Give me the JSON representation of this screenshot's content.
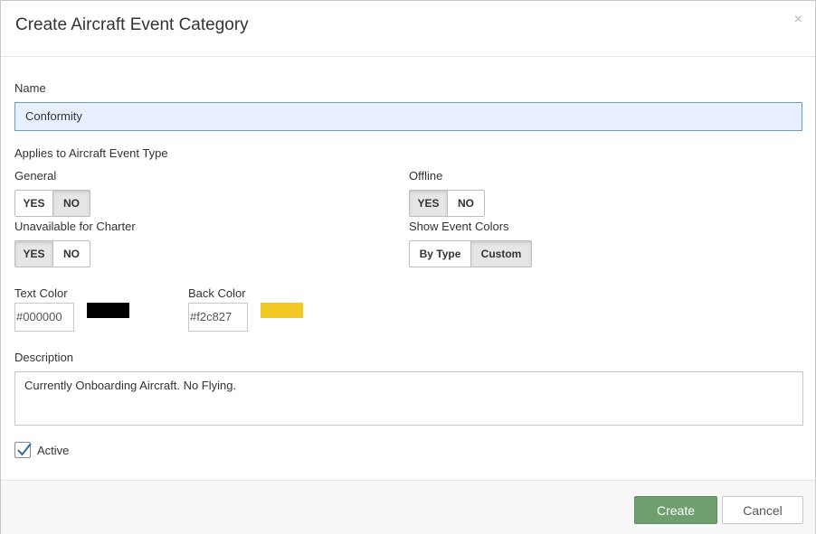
{
  "modal": {
    "title": "Create Aircraft Event Category",
    "close_symbol": "×"
  },
  "form": {
    "name": {
      "label": "Name",
      "value": "Conformity"
    },
    "applies_label": "Applies to Aircraft Event Type",
    "general": {
      "label": "General",
      "yes": "YES",
      "no": "NO",
      "selected": "NO"
    },
    "offline": {
      "label": "Offline",
      "yes": "YES",
      "no": "NO",
      "selected": "YES"
    },
    "unavailable_for_charter": {
      "label": "Unavailable for Charter",
      "yes": "YES",
      "no": "NO",
      "selected": "YES"
    },
    "show_event_colors": {
      "label": "Show Event Colors",
      "by_type": "By Type",
      "custom": "Custom",
      "selected": "Custom"
    },
    "text_color": {
      "label": "Text Color",
      "value": "#000000",
      "swatch": "#000000"
    },
    "back_color": {
      "label": "Back Color",
      "value": "#f2c827",
      "swatch": "#f2c827"
    },
    "description": {
      "label": "Description",
      "value": "Currently Onboarding Aircraft. No Flying."
    },
    "active": {
      "label": "Active",
      "checked": true
    }
  },
  "footer": {
    "create_label": "Create",
    "cancel_label": "Cancel"
  },
  "colors": {
    "create_button": "#6f9e6f",
    "input_focus_border": "#6a9cc4",
    "checkbox_check": "#2a6aa6"
  },
  "icons": {
    "close": "close-icon",
    "check": "checkmark-icon"
  }
}
